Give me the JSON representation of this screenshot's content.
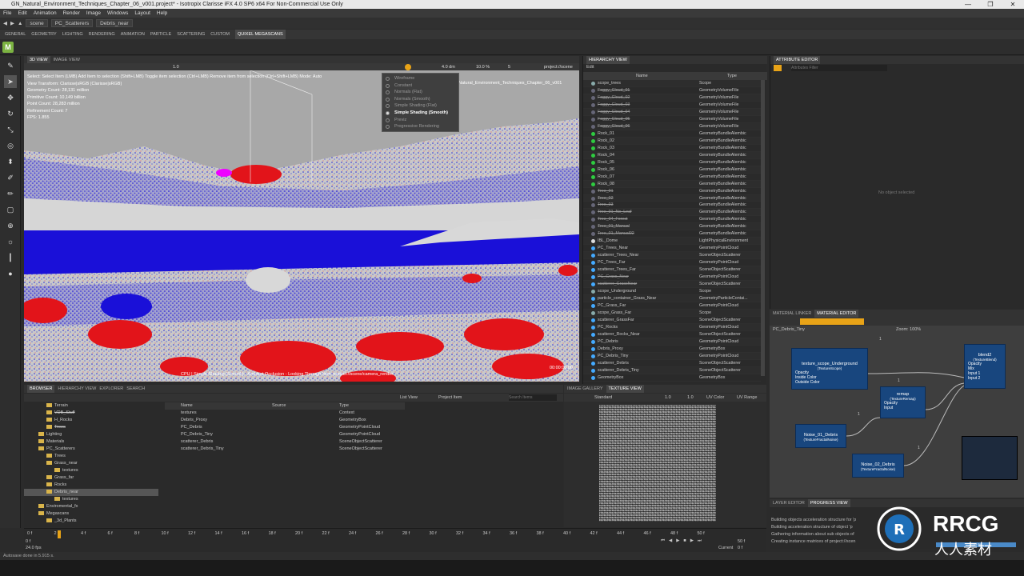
{
  "window": {
    "title": "GN_Natural_Environment_Techniques_Chapter_06_v001.project* - Isotropix Clarisse iFX 4.0 SP6 x64 For Non-Commercial Use Only",
    "controls": [
      "—",
      "❐",
      "✕"
    ]
  },
  "menu": [
    "File",
    "Edit",
    "Animation",
    "Render",
    "Image",
    "Windows",
    "Layout",
    "Help"
  ],
  "address": {
    "items": [
      "scene",
      "PC_Scatterers",
      "Debris_near"
    ]
  },
  "shelf_tabs": [
    "GENERAL",
    "GEOMETRY",
    "LIGHTING",
    "RENDERING",
    "ANIMATION",
    "PARTICLE",
    "SCATTERING",
    "CUSTOM",
    "QUIXEL MEGASCANS"
  ],
  "shelf_tab_active": "QUIXEL MEGASCANS",
  "viewport": {
    "tabs": [
      "3D VIEW",
      "IMAGE VIEW"
    ],
    "toolbar": {
      "zoom": "1.0",
      "distance": "4.0 dm",
      "percent": "10.0 %",
      "samples": "5",
      "camera": "project://scene"
    },
    "info": [
      "Select: Select Item (LMB) Add Item to selection (Shift+LMB) Toggle item selection (Ctrl+LMB) Remove item from selection (Ctrl+Shift+LMB) Mode: Auto",
      "View Transform: Clarisse|sRGB (Clarisse|sRGB)",
      "Geometry Count: 28,131 million",
      "Primitive Count: 10,149 billion",
      "Point Count: 28,283 million",
      "Refinement Count: 7",
      "FPS: 1.855"
    ],
    "project_text": "Natural_Environment_Techniques_Chapter_06_v001",
    "status": "CPU | Simple Shading (Smooth) - Ambient Occlusion - Looking Through Item: project://scene/camera_render",
    "time": "00:00:00:00"
  },
  "shading_menu": {
    "items": [
      "Wireframe",
      "Constant",
      "Normals (Flat)",
      "Normals (Smooth)",
      "Simple Shading (Flat)",
      "Simple Shading (Smooth)",
      "Previz",
      "Progressive Rendering"
    ],
    "selected": "Simple Shading (Smooth)"
  },
  "hierarchy": {
    "tab": "HIERARCHY VIEW",
    "edit": "Edit",
    "col_name": "Name",
    "col_type": "Type",
    "rows": [
      {
        "name": "scope_trees",
        "type": "Scope",
        "strike": false,
        "dot": "#8aa"
      },
      {
        "name": "Foggy_Cloud_01",
        "type": "GeometryVolumeFile",
        "strike": true,
        "dot": "#667"
      },
      {
        "name": "Foggy_Cloud_02",
        "type": "GeometryVolumeFile",
        "strike": true,
        "dot": "#667"
      },
      {
        "name": "Foggy_Cloud_03",
        "type": "GeometryVolumeFile",
        "strike": true,
        "dot": "#667"
      },
      {
        "name": "Foggy_Cloud_04",
        "type": "GeometryVolumeFile",
        "strike": true,
        "dot": "#667"
      },
      {
        "name": "Foggy_Cloud_05",
        "type": "GeometryVolumeFile",
        "strike": true,
        "dot": "#667"
      },
      {
        "name": "Foggy_Cloud_06",
        "type": "GeometryVolumeFile",
        "strike": true,
        "dot": "#667"
      },
      {
        "name": "Rock_01",
        "type": "GeometryBundleAlembic",
        "strike": false,
        "dot": "#2ecc40"
      },
      {
        "name": "Rock_02",
        "type": "GeometryBundleAlembic",
        "strike": false,
        "dot": "#2ecc40"
      },
      {
        "name": "Rock_03",
        "type": "GeometryBundleAlembic",
        "strike": false,
        "dot": "#2ecc40"
      },
      {
        "name": "Rock_04",
        "type": "GeometryBundleAlembic",
        "strike": false,
        "dot": "#2ecc40"
      },
      {
        "name": "Rock_05",
        "type": "GeometryBundleAlembic",
        "strike": false,
        "dot": "#2ecc40"
      },
      {
        "name": "Rock_06",
        "type": "GeometryBundleAlembic",
        "strike": false,
        "dot": "#2ecc40"
      },
      {
        "name": "Rock_07",
        "type": "GeometryBundleAlembic",
        "strike": false,
        "dot": "#2ecc40"
      },
      {
        "name": "Rock_08",
        "type": "GeometryBundleAlembic",
        "strike": false,
        "dot": "#2ecc40"
      },
      {
        "name": "Tree_01",
        "type": "GeometryBundleAlembic",
        "strike": true,
        "dot": "#667"
      },
      {
        "name": "Tree_02",
        "type": "GeometryBundleAlembic",
        "strike": true,
        "dot": "#667"
      },
      {
        "name": "Tree_03",
        "type": "GeometryBundleAlembic",
        "strike": true,
        "dot": "#667"
      },
      {
        "name": "Tree_01_No_Leaf",
        "type": "GeometryBundleAlembic",
        "strike": true,
        "dot": "#667"
      },
      {
        "name": "Tree_04_Forest",
        "type": "GeometryBundleAlembic",
        "strike": true,
        "dot": "#667"
      },
      {
        "name": "Tree_01_Manual",
        "type": "GeometryBundleAlembic",
        "strike": true,
        "dot": "#667"
      },
      {
        "name": "Tree_01_Manual02",
        "type": "GeometryBundleAlembic",
        "strike": true,
        "dot": "#667"
      },
      {
        "name": "IBL_Dome",
        "type": "LightPhysicalEnvironment",
        "strike": false,
        "dot": "#ddd"
      },
      {
        "name": "PC_Trees_Near",
        "type": "GeometryPointCloud",
        "strike": false,
        "dot": "#4af"
      },
      {
        "name": "scatterer_Trees_Near",
        "type": "SceneObjectScatterer",
        "strike": false,
        "dot": "#4af"
      },
      {
        "name": "PC_Trees_Far",
        "type": "GeometryPointCloud",
        "strike": false,
        "dot": "#4af"
      },
      {
        "name": "scatterer_Trees_Far",
        "type": "SceneObjectScatterer",
        "strike": false,
        "dot": "#4af"
      },
      {
        "name": "PC_Grass_Near",
        "type": "GeometryPointCloud",
        "strike": true,
        "dot": "#4af"
      },
      {
        "name": "scatterer_GrassNear",
        "type": "SceneObjectScatterer",
        "strike": true,
        "dot": "#4af"
      },
      {
        "name": "scope_Underground",
        "type": "Scope",
        "strike": false,
        "dot": "#8aa"
      },
      {
        "name": "particle_container_Grass_Near",
        "type": "GeometryParticleContai...",
        "strike": false,
        "dot": "#4af"
      },
      {
        "name": "PC_Grass_Far",
        "type": "GeometryPointCloud",
        "strike": false,
        "dot": "#4af"
      },
      {
        "name": "scope_Grass_Far",
        "type": "Scope",
        "strike": false,
        "dot": "#8aa"
      },
      {
        "name": "scatterer_GrassFar",
        "type": "SceneObjectScatterer",
        "strike": false,
        "dot": "#4af"
      },
      {
        "name": "PC_Rocks",
        "type": "GeometryPointCloud",
        "strike": false,
        "dot": "#4af"
      },
      {
        "name": "scatterer_Rocks_Near",
        "type": "SceneObjectScatterer",
        "strike": false,
        "dot": "#4af"
      },
      {
        "name": "PC_Debris",
        "type": "GeometryPointCloud",
        "strike": false,
        "dot": "#4af"
      },
      {
        "name": "Debris_Proxy",
        "type": "GeometryBox",
        "strike": false,
        "dot": "#4af"
      },
      {
        "name": "PC_Debris_Tiny",
        "type": "GeometryPointCloud",
        "strike": false,
        "dot": "#4af"
      },
      {
        "name": "scatterer_Debris",
        "type": "SceneObjectScatterer",
        "strike": false,
        "dot": "#4af"
      },
      {
        "name": "scatterer_Debris_Tiny",
        "type": "SceneObjectScatterer",
        "strike": false,
        "dot": "#4af"
      },
      {
        "name": "GeometryBox",
        "type": "GeometryBox",
        "strike": false,
        "dot": "#4af"
      }
    ]
  },
  "attribute_editor": {
    "tab": "ATTRIBUTE EDITOR",
    "filter_placeholder": "Attributes Filter",
    "empty": "No object selected"
  },
  "material_editor": {
    "tabs": [
      "MATERIAL LINKER",
      "MATERIAL EDITOR"
    ],
    "path": "PC_Debris_Tiny",
    "zoom": "Zoom: 100%",
    "nodes": [
      {
        "title": "texture_scope_Underground",
        "sub": "(TextureScope)",
        "ports": [
          "Opacity",
          "Inside Color",
          "Outside Color"
        ]
      },
      {
        "title": "remap",
        "sub": "(TextureRemap)",
        "ports": [
          "Opacity",
          "Input"
        ]
      },
      {
        "title": "blend2",
        "sub": "(TextureBlend)",
        "ports": [
          "Opacity",
          "Mix",
          "Input 1",
          "Input 2"
        ]
      },
      {
        "title": "Noise_01_Debris",
        "sub": "(TextureFractalNoise)",
        "ports": []
      },
      {
        "title": "Noise_02_Debris",
        "sub": "(TextureFractalNoise)",
        "ports": []
      }
    ],
    "badges": [
      "1",
      "1",
      "1",
      "1"
    ]
  },
  "progress": {
    "tabs": [
      "LAYER EDITOR",
      "PROGRESS VIEW"
    ],
    "lines": [
      "Building objects acceleration structure for 'p",
      "Building acceleration structure of object 'p",
      "Gathering information about sub objects of",
      "Creating instance matrices of project://scen"
    ],
    "percent": "100 %"
  },
  "browser": {
    "tabs": [
      "BROWSER",
      "HIERARCHY VIEW",
      "EXPLORER",
      "SEARCH"
    ],
    "view_mode": "List View",
    "scope": "Project Item",
    "search_placeholder": "Search Items",
    "tree": [
      {
        "label": "Terrain",
        "indent": 2,
        "strike": false
      },
      {
        "label": "VDB_Stuff",
        "indent": 2,
        "strike": true
      },
      {
        "label": "H_Rocks",
        "indent": 2,
        "strike": false
      },
      {
        "label": "Trees",
        "indent": 2,
        "strike": true
      },
      {
        "label": "Lighting",
        "indent": 1,
        "strike": false
      },
      {
        "label": "Materials",
        "indent": 1,
        "strike": false
      },
      {
        "label": "PC_Scatterers",
        "indent": 1,
        "strike": false
      },
      {
        "label": "Trees",
        "indent": 2,
        "strike": false
      },
      {
        "label": "Grass_near",
        "indent": 2,
        "strike": false
      },
      {
        "label": "textures",
        "indent": 3,
        "strike": false
      },
      {
        "label": "Grass_far",
        "indent": 2,
        "strike": false
      },
      {
        "label": "Rocks",
        "indent": 2,
        "strike": false
      },
      {
        "label": "Debris_near",
        "indent": 2,
        "strike": false
      },
      {
        "label": "textures",
        "indent": 3,
        "strike": false
      },
      {
        "label": "Enviromental_fx",
        "indent": 1,
        "strike": false
      },
      {
        "label": "Megascans",
        "indent": 1,
        "strike": false
      },
      {
        "label": "_3d_Plants",
        "indent": 2,
        "strike": false
      }
    ],
    "selected_tree": "Debris_near",
    "columns": [
      "Name",
      "Source",
      "Type"
    ],
    "items": [
      {
        "name": "textures",
        "source": "",
        "type": "Context"
      },
      {
        "name": "Debris_Proxy",
        "source": "",
        "type": "GeometryBox"
      },
      {
        "name": "PC_Debris",
        "source": "",
        "type": "GeometryPointCloud"
      },
      {
        "name": "PC_Debris_Tiny",
        "source": "",
        "type": "GeometryPointCloud"
      },
      {
        "name": "scatterer_Debris",
        "source": "",
        "type": "SceneObjectScatterer"
      },
      {
        "name": "scatterer_Debris_Tiny",
        "source": "",
        "type": "SceneObjectScatterer"
      }
    ]
  },
  "texture_view": {
    "tabs": [
      "IMAGE GALLERY",
      "TEXTURE VIEW"
    ],
    "mode": "Standard",
    "value1": "1.0",
    "value2": "1.0",
    "uv_color": "UV Color",
    "uv_range": "UV Range"
  },
  "timeline": {
    "ticks": [
      "0 f",
      "2 f",
      "4 f",
      "6 f",
      "8 f",
      "10 f",
      "12 f",
      "14 f",
      "16 f",
      "18 f",
      "20 f",
      "22 f",
      "24 f",
      "26 f",
      "28 f",
      "30 f",
      "32 f",
      "34 f",
      "36 f",
      "38 f",
      "40 f",
      "42 f",
      "44 f",
      "46 f",
      "48 f",
      "50 f"
    ],
    "start": "0 f",
    "end": "50 f",
    "fps": "24.0 fps",
    "current_label": "Current",
    "current": "0 f"
  },
  "statusbar": {
    "text": "Autosave done in 5.915 s."
  },
  "watermark": {
    "brand": "RRCG",
    "sub": "人人素材"
  },
  "colors": {
    "accent": "#e8a317",
    "viewport_blue": "#1a10d8",
    "viewport_red": "#e2141a",
    "node_blue": "#18467e"
  }
}
